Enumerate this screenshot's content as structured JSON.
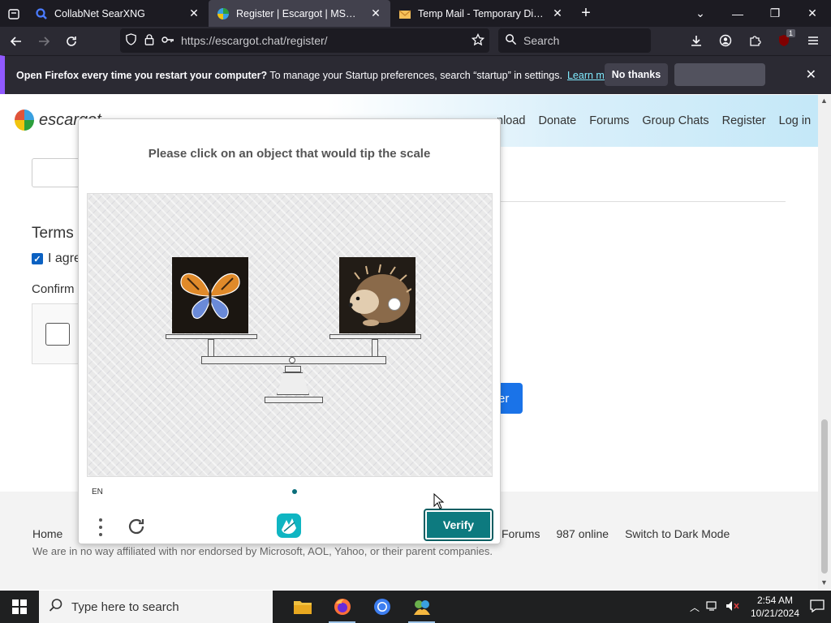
{
  "browser": {
    "tabs": [
      {
        "title": "CollabNet SearXNG",
        "active": false
      },
      {
        "title": "Register | Escargot | MSN Messen",
        "active": true
      },
      {
        "title": "Temp Mail - Temporary Disposab",
        "active": false
      }
    ],
    "url": "https://escargot.chat/register/",
    "search_placeholder": "Search",
    "extension_badge": "1"
  },
  "notification": {
    "bold_text": "Open Firefox every time you restart your computer?",
    "text": " To manage your Startup preferences, search “startup” in settings.",
    "learn_more": "Learn more",
    "no_thanks": "No thanks"
  },
  "site": {
    "logo_text": "escargot",
    "nav": [
      "nload",
      "Donate",
      "Forums",
      "Group Chats",
      "Register",
      "Log in"
    ],
    "terms_heading": "Terms",
    "agree_label": "I agre",
    "confirm_label": "Confirm",
    "register_btn": "er",
    "footer": {
      "home": "Home",
      "right_links": [
        "Forums",
        "987 online",
        "Switch to Dark Mode"
      ],
      "disclaimer": "We are in no way affiliated with nor endorsed by Microsoft, AOL, Yahoo, or their parent companies."
    }
  },
  "captcha": {
    "prompt": "Please click on an object that would tip the scale",
    "language": "EN",
    "verify": "Verify",
    "left_object": "butterfly",
    "right_object": "hedgehog"
  },
  "taskbar": {
    "search_placeholder": "Type here to search",
    "time": "2:54 AM",
    "date": "10/21/2024"
  },
  "colors": {
    "verify": "#0d7a7f",
    "register": "#1a73e8",
    "firefox_chrome": "#2b2a33"
  }
}
